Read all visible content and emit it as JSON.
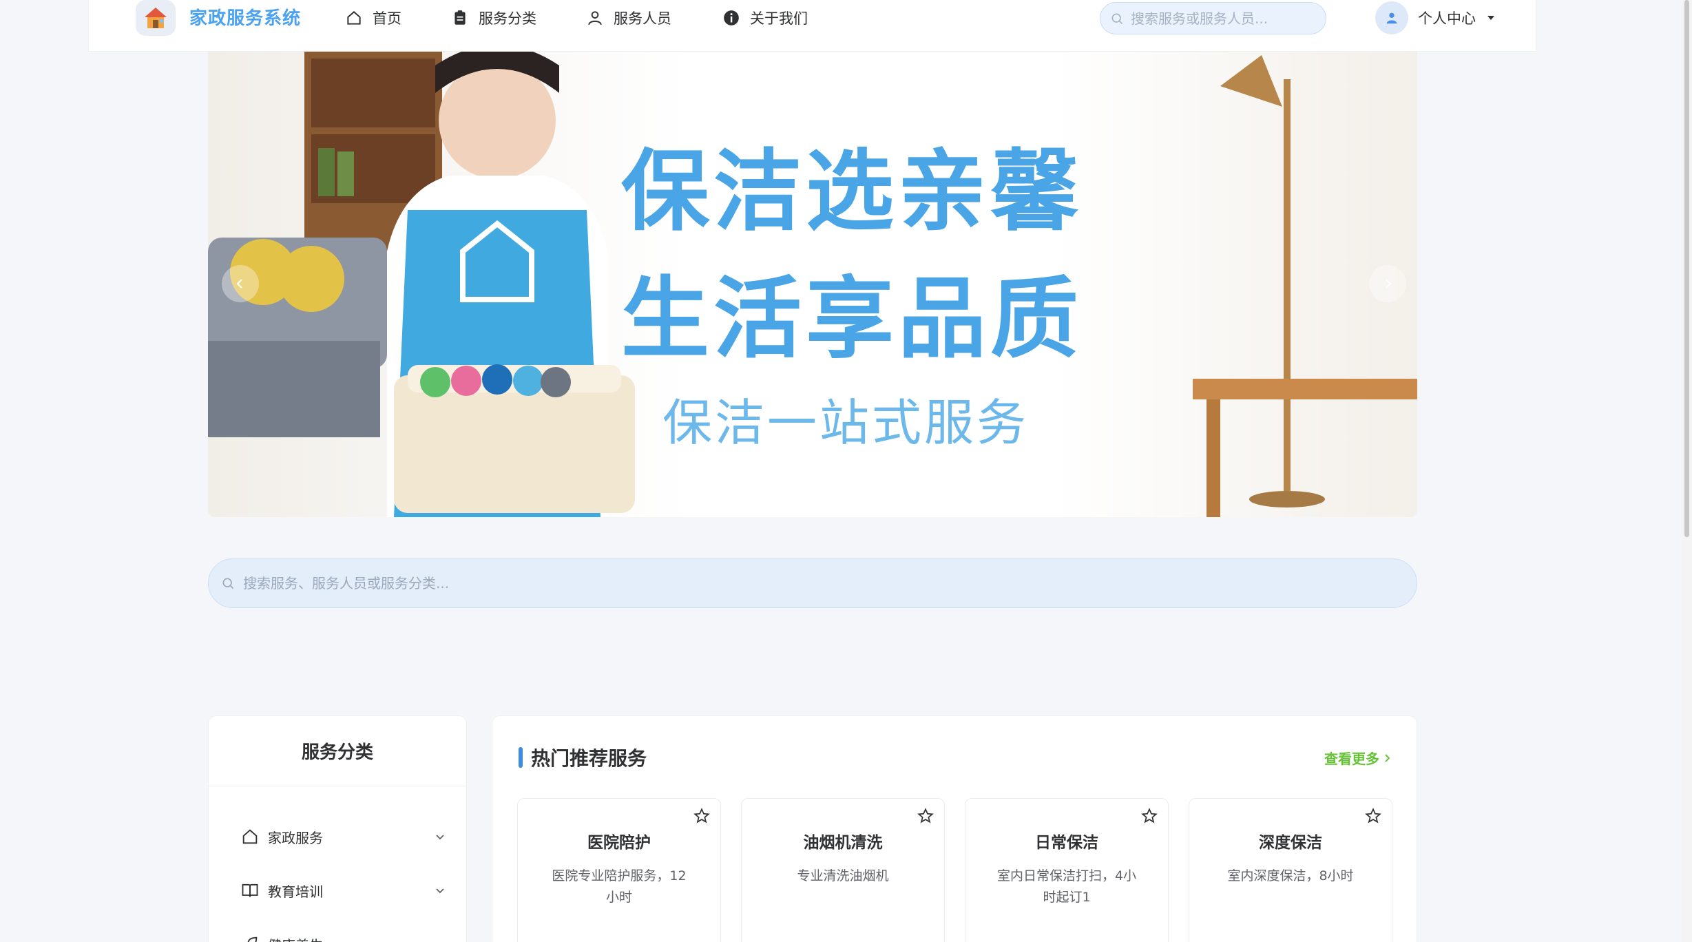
{
  "header": {
    "app_title": "家政服务系统",
    "logo_icon": "house-icon",
    "nav": [
      {
        "label": "首页",
        "icon": "home-icon"
      },
      {
        "label": "服务分类",
        "icon": "clipboard-icon"
      },
      {
        "label": "服务人员",
        "icon": "user-icon"
      },
      {
        "label": "关于我们",
        "icon": "info-icon"
      }
    ],
    "search_placeholder": "搜索服务或服务人员...",
    "user_label": "个人中心"
  },
  "banner": {
    "line1": "保洁选亲馨",
    "line2": "生活享品质",
    "line3": "保洁一站式服务",
    "accent_color": "#4aa5e6"
  },
  "main_search": {
    "placeholder": "搜索服务、服务人员或服务分类..."
  },
  "sidebar": {
    "title": "服务分类",
    "items": [
      {
        "label": "家政服务",
        "icon": "home-icon"
      },
      {
        "label": "教育培训",
        "icon": "book-icon"
      },
      {
        "label": "健康养生",
        "icon": "leaf-icon"
      }
    ]
  },
  "hot": {
    "title": "热门推荐服务",
    "more_label": "查看更多",
    "services": [
      {
        "name": "医院陪护",
        "desc": "医院专业陪护服务，12小时"
      },
      {
        "name": "油烟机清洗",
        "desc": "专业清洗油烟机"
      },
      {
        "name": "日常保洁",
        "desc": "室内日常保洁打扫，4小时起订1"
      },
      {
        "name": "深度保洁",
        "desc": "室内深度保洁，8小时"
      }
    ]
  }
}
